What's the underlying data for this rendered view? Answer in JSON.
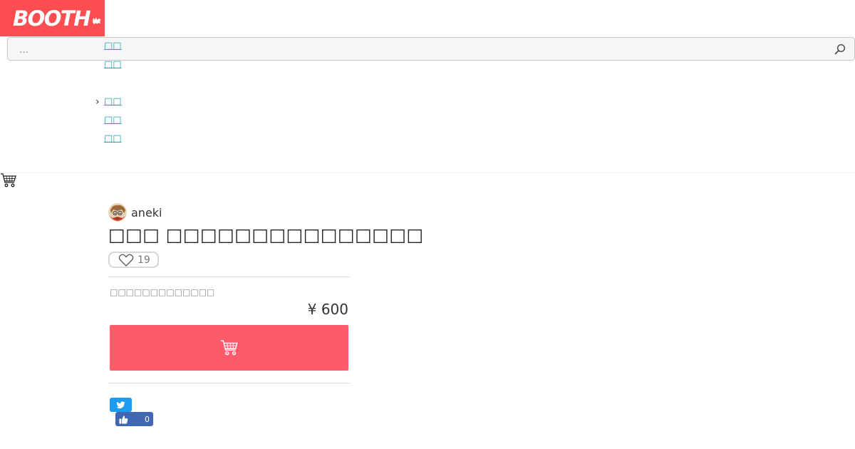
{
  "header": {
    "logo_text": "BOOTH",
    "brand_color": "#fc4d50"
  },
  "search": {
    "placeholder": "…"
  },
  "nav": {
    "links": [
      "□□",
      "□□",
      "□□",
      "□□",
      "□□"
    ]
  },
  "shop": {
    "name": "aneki"
  },
  "item": {
    "title": "□□□ □□□□□□□□□□□□□□□",
    "likes": "19",
    "variation": "□□□□□□□□□□□□□",
    "price": "¥ 600"
  },
  "social": {
    "fb_like_count": "0"
  },
  "icons": [
    "search-icon",
    "cart-icon",
    "heart-icon",
    "twitter-icon",
    "thumbs-up-icon",
    "chevron-right-icon"
  ],
  "colors": {
    "accent": "#23a4b5",
    "buy_button": "#fc5b6a",
    "twitter": "#1d9bf0",
    "facebook": "#4267b2"
  }
}
